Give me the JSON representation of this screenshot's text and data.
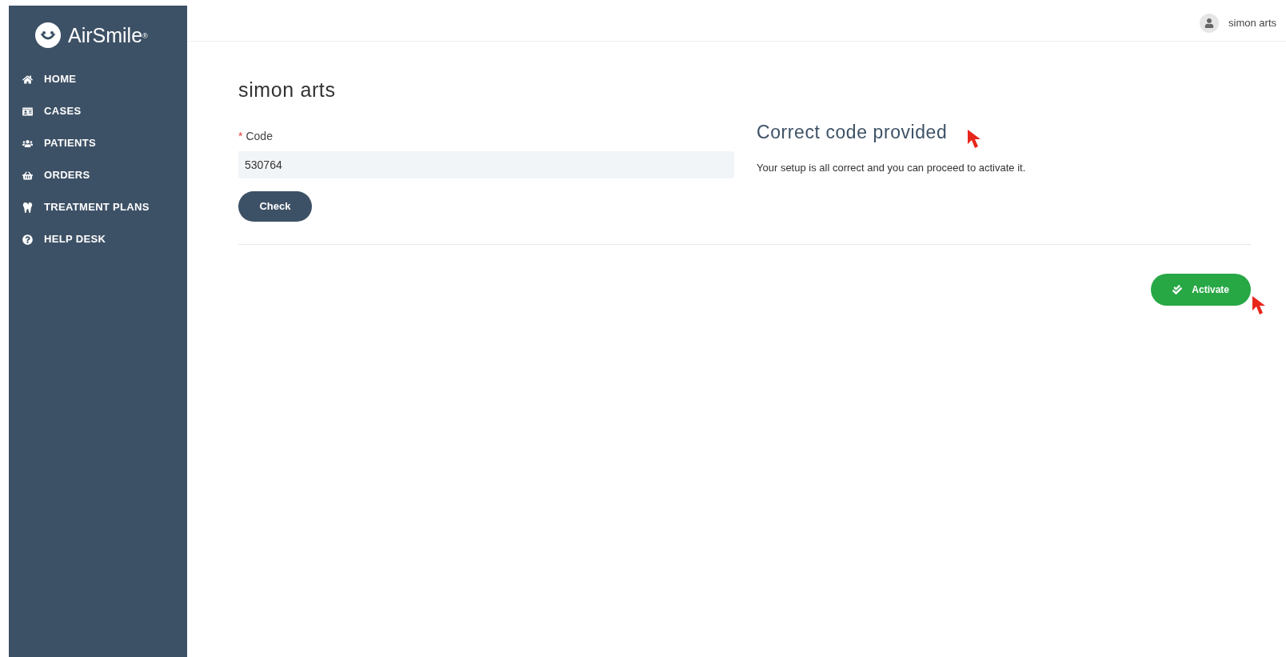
{
  "sidebar": {
    "logo": "AirSmile",
    "logo_mark": "®",
    "items": [
      {
        "kind": "home",
        "label": "HOME"
      },
      {
        "kind": "cases",
        "label": "CASES"
      },
      {
        "kind": "patients",
        "label": "PATIENTS"
      },
      {
        "kind": "orders",
        "label": "ORDERS"
      },
      {
        "kind": "treatment",
        "label": "TREATMENT PLANS"
      },
      {
        "kind": "help",
        "label": "HELP DESK"
      }
    ]
  },
  "header": {
    "user": "simon arts"
  },
  "page": {
    "title": "simon arts",
    "code_field": {
      "required_mark": "*",
      "label": "Code",
      "value": "530764"
    },
    "check_button": "Check",
    "result": {
      "heading": "Correct code provided",
      "message": "Your setup is all correct and you can proceed to activate it."
    },
    "activate_button": "Activate"
  }
}
